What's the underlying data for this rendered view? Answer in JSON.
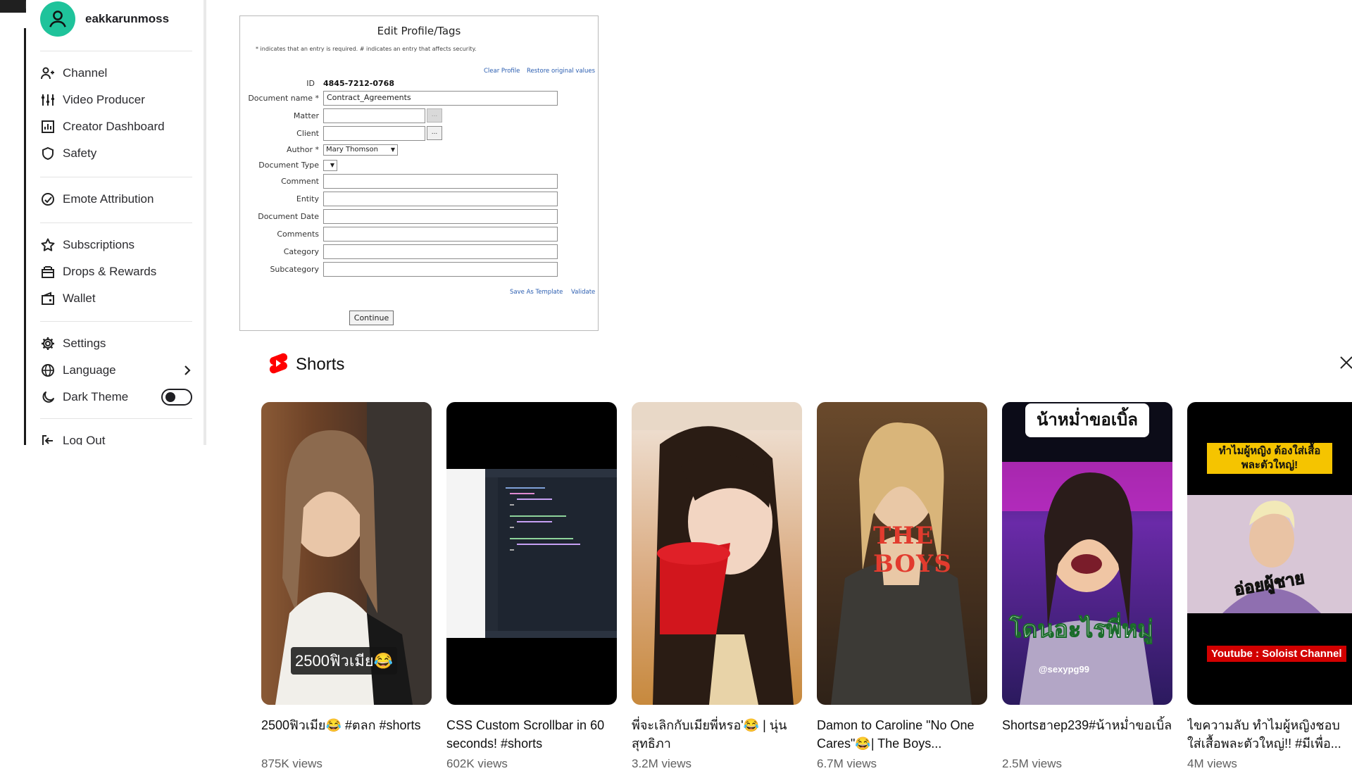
{
  "menu": {
    "edge_tag": "bot",
    "username": "eakkarunmoss",
    "items": [
      {
        "label": "Channel",
        "icon": "channel-icon"
      },
      {
        "label": "Video Producer",
        "icon": "video-producer-icon"
      },
      {
        "label": "Creator Dashboard",
        "icon": "creator-dashboard-icon"
      },
      {
        "label": "Safety",
        "icon": "shield-icon"
      },
      {
        "label": "Emote Attribution",
        "icon": "emote-icon"
      },
      {
        "label": "Subscriptions",
        "icon": "star-icon"
      },
      {
        "label": "Drops & Rewards",
        "icon": "gift-icon"
      },
      {
        "label": "Wallet",
        "icon": "wallet-icon"
      },
      {
        "label": "Settings",
        "icon": "gear-icon"
      },
      {
        "label": "Language",
        "icon": "globe-icon"
      },
      {
        "label": "Dark Theme",
        "icon": "moon-icon"
      },
      {
        "label": "Log Out",
        "icon": "logout-icon"
      }
    ],
    "dark_theme_enabled": false,
    "avatar_color": "#1fc39b"
  },
  "form": {
    "title": "Edit Profile/Tags",
    "note": "* indicates that an entry is required.   # indicates an entry that affects security.",
    "links": {
      "clear_profile": "Clear Profile",
      "restore": "Restore original values",
      "save_template": "Save As Template",
      "validate": "Validate"
    },
    "id_label": "ID",
    "id_value": "4845-7212-0768",
    "labels": {
      "document_name": "Document name *",
      "matter": "Matter",
      "client": "Client",
      "author": "Author *",
      "document_type": "Document Type",
      "comment": "Comment",
      "entity": "Entity",
      "document_date": "Document Date",
      "comments": "Comments",
      "category": "Category",
      "subcategory": "Subcategory"
    },
    "values": {
      "document_name": "Contract_Agreements",
      "matter": "",
      "client": "",
      "author": "Mary Thomson",
      "document_type": "",
      "comment": "",
      "entity": "",
      "document_date": "",
      "comments": "",
      "category": "",
      "subcategory": ""
    },
    "browse_label": "...",
    "continue_label": "Continue"
  },
  "shorts": {
    "title": "Shorts",
    "brand_color": "#ff0000",
    "items": [
      {
        "title": "2500ฟิวเมีย😂 #ตลก #shorts",
        "views": "875K views",
        "caption": "2500ฟิวเมีย😂"
      },
      {
        "title": "CSS Custom Scrollbar in 60 seconds! #shorts",
        "views": "602K views"
      },
      {
        "title": "พี่จะเลิกกับเมียพี่หรอ'😂 | นุ่น สุทธิภา",
        "views": "3.2M views"
      },
      {
        "title": "Damon to Caroline \"No One Cares\"😂| The Boys...",
        "views": "6.7M views",
        "overlay": "THE BOYS"
      },
      {
        "title": "Shortsฮาep239#น้าหม่ำขอเบิ้ล",
        "views": "2.5M views",
        "banner": "น้าหม่ำขอเบิ้ล",
        "caption": "โดนอะไรพี่หมู่",
        "handle": "@sexypg99"
      },
      {
        "title": "ไขความลับ ทำไมผู้หญิงชอบใส่เสื้อพละตัวใหญ่!! #มีเพื่อ...",
        "views": "4M views",
        "top_text": "ทำไมผู้หญิง ต้องใส่เสื้อพละตัวใหญ่!",
        "mid_text": "อ่อยผู้ชาย",
        "channel": "Youtube : Soloist Channel"
      }
    ]
  }
}
